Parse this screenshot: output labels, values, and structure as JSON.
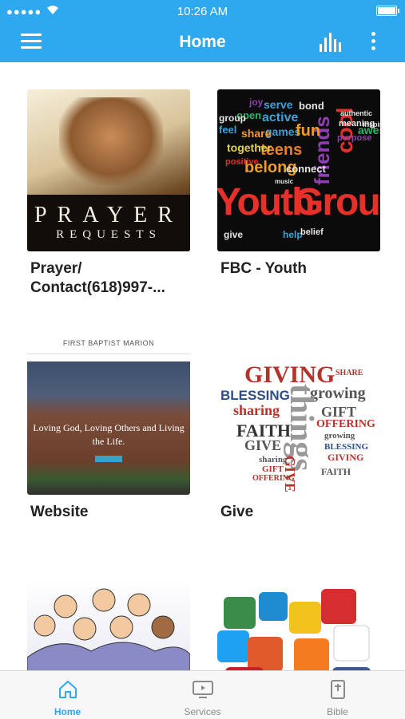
{
  "status": {
    "time": "10:26 AM"
  },
  "header": {
    "title": "Home"
  },
  "tiles": [
    {
      "label": "Prayer/\nContact(618)997-...",
      "image": {
        "title": "PRAYER",
        "subtitle": "REQUESTS"
      }
    },
    {
      "label": "FBC - Youth",
      "image": {
        "words": [
          "Youth",
          "Group",
          "friends",
          "cool",
          "belong",
          "teens",
          "connect",
          "serve",
          "active",
          "games",
          "fun",
          "share",
          "together",
          "positive",
          "open",
          "joy",
          "bond",
          "meaning",
          "purpose",
          "awesome",
          "inspire",
          "authentic",
          "help",
          "belief",
          "give",
          "music",
          "feel",
          "group"
        ]
      }
    },
    {
      "label": "Website",
      "image": {
        "header": "FIRST BAPTIST MARION",
        "tagline": "Loving God, Loving Others and Living the Life."
      }
    },
    {
      "label": "Give",
      "image": {
        "words": [
          "GIVING",
          "BLESSING",
          "growing",
          "sharing",
          "FAITH",
          "GIFT",
          "OFFERING",
          "GIVE",
          "things",
          "SHARE",
          "growing",
          "BLESSING",
          "GIVING",
          "FAITH",
          "sharing",
          "GIFT",
          "GIVE",
          "OFFERING"
        ]
      }
    },
    {
      "label": "",
      "image": {
        "name": "choir"
      }
    },
    {
      "label": "",
      "image": {
        "name": "social-media"
      }
    }
  ],
  "tabbar": {
    "items": [
      {
        "label": "Home",
        "icon": "home-icon"
      },
      {
        "label": "Services",
        "icon": "tv-icon"
      },
      {
        "label": "Bible",
        "icon": "bible-icon"
      }
    ]
  },
  "colors": {
    "primary": "#2ea8ee",
    "tab_inactive": "#8a8a8a"
  }
}
